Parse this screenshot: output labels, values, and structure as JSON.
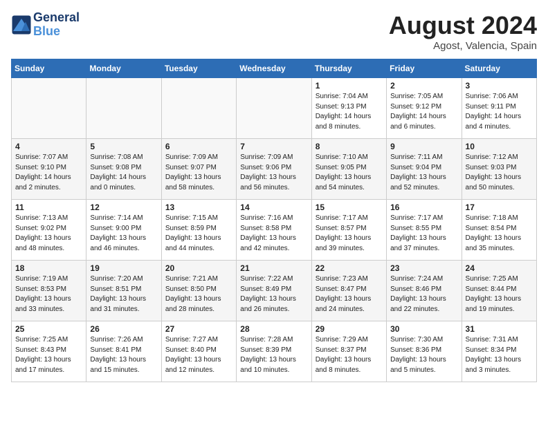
{
  "header": {
    "logo_line1": "General",
    "logo_line2": "Blue",
    "month": "August 2024",
    "location": "Agost, Valencia, Spain"
  },
  "weekdays": [
    "Sunday",
    "Monday",
    "Tuesday",
    "Wednesday",
    "Thursday",
    "Friday",
    "Saturday"
  ],
  "weeks": [
    [
      {
        "day": "",
        "info": ""
      },
      {
        "day": "",
        "info": ""
      },
      {
        "day": "",
        "info": ""
      },
      {
        "day": "",
        "info": ""
      },
      {
        "day": "1",
        "info": "Sunrise: 7:04 AM\nSunset: 9:13 PM\nDaylight: 14 hours\nand 8 minutes."
      },
      {
        "day": "2",
        "info": "Sunrise: 7:05 AM\nSunset: 9:12 PM\nDaylight: 14 hours\nand 6 minutes."
      },
      {
        "day": "3",
        "info": "Sunrise: 7:06 AM\nSunset: 9:11 PM\nDaylight: 14 hours\nand 4 minutes."
      }
    ],
    [
      {
        "day": "4",
        "info": "Sunrise: 7:07 AM\nSunset: 9:10 PM\nDaylight: 14 hours\nand 2 minutes."
      },
      {
        "day": "5",
        "info": "Sunrise: 7:08 AM\nSunset: 9:08 PM\nDaylight: 14 hours\nand 0 minutes."
      },
      {
        "day": "6",
        "info": "Sunrise: 7:09 AM\nSunset: 9:07 PM\nDaylight: 13 hours\nand 58 minutes."
      },
      {
        "day": "7",
        "info": "Sunrise: 7:09 AM\nSunset: 9:06 PM\nDaylight: 13 hours\nand 56 minutes."
      },
      {
        "day": "8",
        "info": "Sunrise: 7:10 AM\nSunset: 9:05 PM\nDaylight: 13 hours\nand 54 minutes."
      },
      {
        "day": "9",
        "info": "Sunrise: 7:11 AM\nSunset: 9:04 PM\nDaylight: 13 hours\nand 52 minutes."
      },
      {
        "day": "10",
        "info": "Sunrise: 7:12 AM\nSunset: 9:03 PM\nDaylight: 13 hours\nand 50 minutes."
      }
    ],
    [
      {
        "day": "11",
        "info": "Sunrise: 7:13 AM\nSunset: 9:02 PM\nDaylight: 13 hours\nand 48 minutes."
      },
      {
        "day": "12",
        "info": "Sunrise: 7:14 AM\nSunset: 9:00 PM\nDaylight: 13 hours\nand 46 minutes."
      },
      {
        "day": "13",
        "info": "Sunrise: 7:15 AM\nSunset: 8:59 PM\nDaylight: 13 hours\nand 44 minutes."
      },
      {
        "day": "14",
        "info": "Sunrise: 7:16 AM\nSunset: 8:58 PM\nDaylight: 13 hours\nand 42 minutes."
      },
      {
        "day": "15",
        "info": "Sunrise: 7:17 AM\nSunset: 8:57 PM\nDaylight: 13 hours\nand 39 minutes."
      },
      {
        "day": "16",
        "info": "Sunrise: 7:17 AM\nSunset: 8:55 PM\nDaylight: 13 hours\nand 37 minutes."
      },
      {
        "day": "17",
        "info": "Sunrise: 7:18 AM\nSunset: 8:54 PM\nDaylight: 13 hours\nand 35 minutes."
      }
    ],
    [
      {
        "day": "18",
        "info": "Sunrise: 7:19 AM\nSunset: 8:53 PM\nDaylight: 13 hours\nand 33 minutes."
      },
      {
        "day": "19",
        "info": "Sunrise: 7:20 AM\nSunset: 8:51 PM\nDaylight: 13 hours\nand 31 minutes."
      },
      {
        "day": "20",
        "info": "Sunrise: 7:21 AM\nSunset: 8:50 PM\nDaylight: 13 hours\nand 28 minutes."
      },
      {
        "day": "21",
        "info": "Sunrise: 7:22 AM\nSunset: 8:49 PM\nDaylight: 13 hours\nand 26 minutes."
      },
      {
        "day": "22",
        "info": "Sunrise: 7:23 AM\nSunset: 8:47 PM\nDaylight: 13 hours\nand 24 minutes."
      },
      {
        "day": "23",
        "info": "Sunrise: 7:24 AM\nSunset: 8:46 PM\nDaylight: 13 hours\nand 22 minutes."
      },
      {
        "day": "24",
        "info": "Sunrise: 7:25 AM\nSunset: 8:44 PM\nDaylight: 13 hours\nand 19 minutes."
      }
    ],
    [
      {
        "day": "25",
        "info": "Sunrise: 7:25 AM\nSunset: 8:43 PM\nDaylight: 13 hours\nand 17 minutes."
      },
      {
        "day": "26",
        "info": "Sunrise: 7:26 AM\nSunset: 8:41 PM\nDaylight: 13 hours\nand 15 minutes."
      },
      {
        "day": "27",
        "info": "Sunrise: 7:27 AM\nSunset: 8:40 PM\nDaylight: 13 hours\nand 12 minutes."
      },
      {
        "day": "28",
        "info": "Sunrise: 7:28 AM\nSunset: 8:39 PM\nDaylight: 13 hours\nand 10 minutes."
      },
      {
        "day": "29",
        "info": "Sunrise: 7:29 AM\nSunset: 8:37 PM\nDaylight: 13 hours\nand 8 minutes."
      },
      {
        "day": "30",
        "info": "Sunrise: 7:30 AM\nSunset: 8:36 PM\nDaylight: 13 hours\nand 5 minutes."
      },
      {
        "day": "31",
        "info": "Sunrise: 7:31 AM\nSunset: 8:34 PM\nDaylight: 13 hours\nand 3 minutes."
      }
    ]
  ]
}
